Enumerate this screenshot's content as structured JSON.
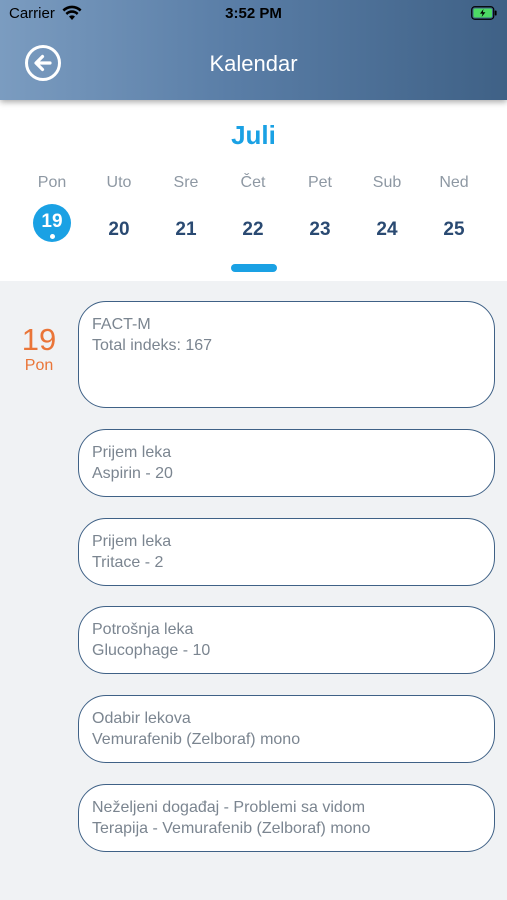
{
  "status_bar": {
    "carrier": "Carrier",
    "time": "3:52 PM"
  },
  "header": {
    "title": "Kalendar",
    "back_icon": "arrow-left-circle-icon"
  },
  "calendar": {
    "month": "Juli",
    "weekdays": [
      "Pon",
      "Uto",
      "Sre",
      "Čet",
      "Pet",
      "Sub",
      "Ned"
    ],
    "days": [
      "19",
      "20",
      "21",
      "22",
      "23",
      "24",
      "25"
    ],
    "selected_day": "19"
  },
  "timeline": {
    "date_number": "19",
    "date_weekday": "Pon",
    "events": [
      {
        "line1": "FACT-M",
        "line2": "Total indeks: 167"
      },
      {
        "line1": "Prijem leka",
        "line2": "Aspirin - 20"
      },
      {
        "line1": "Prijem leka",
        "line2": "Tritace - 2"
      },
      {
        "line1": "Potrošnja leka",
        "line2": "Glucophage - 10"
      },
      {
        "line1": "Odabir lekova",
        "line2": "Vemurafenib (Zelboraf) mono"
      },
      {
        "line1": "Neželjeni događaj - Problemi sa vidom",
        "line2": "Terapija - Vemurafenib (Zelboraf) mono"
      }
    ]
  },
  "colors": {
    "accent": "#1aa1e4",
    "navy": "#3f6186",
    "orange": "#ea7538"
  }
}
